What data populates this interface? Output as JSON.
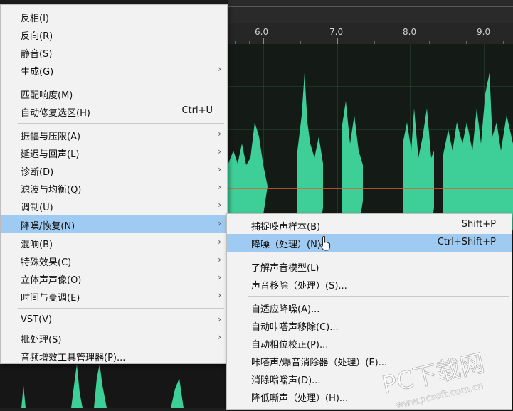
{
  "ruler": {
    "ticks": [
      "6.0",
      "7.0",
      "8.0",
      "9.0"
    ]
  },
  "main_menu": {
    "invert": "反相(I)",
    "reverse": "反向(R)",
    "silence": "静音(S)",
    "generate": "生成(G)",
    "match_loudness": "匹配响度(M)",
    "auto_heal": "自动修复选区(H)",
    "auto_heal_shortcut": "Ctrl+U",
    "amplitude": "振幅与压限(A)",
    "delay_echo": "延迟与回声(L)",
    "diagnostics": "诊断(D)",
    "filter_eq": "滤波与均衡(Q)",
    "modulation": "调制(U)",
    "noise_reduction": "降噪/恢复(N)",
    "reverb": "混响(B)",
    "special": "特殊效果(C)",
    "stereo": "立体声声像(O)",
    "time_pitch": "时间与变调(E)",
    "vst": "VST(V)",
    "batch": "批处理(S)",
    "plugin_manager": "音频增效工具管理器(P)..."
  },
  "sub_menu": {
    "capture_noise": "捕捉噪声样本(B)",
    "capture_noise_shortcut": "Shift+P",
    "noise_reduction_process": "降噪（处理）(N)...",
    "noise_reduction_shortcut": "Ctrl+Shift+P",
    "learn_sound_model": "了解声音模型(L)",
    "sound_remover": "声音移除（处理）(S)...",
    "adaptive_noise": "自适应降噪(A)...",
    "auto_click_remover": "自动咔嗒声移除(C)...",
    "auto_phase": "自动相位校正(P)...",
    "click_pop": "咔嗒声/爆音消除器（处理）(E)...",
    "dehummer": "消除嗡嗡声(D)...",
    "hiss": "降低嘶声（处理）(H)..."
  },
  "watermark": {
    "brand": "PC下载网",
    "url": "www.pcsoft.com.cn"
  },
  "colors": {
    "highlight": "#9fcbf3",
    "waveform": "#3ecf98",
    "menu_bg": "#f2f2f2"
  }
}
